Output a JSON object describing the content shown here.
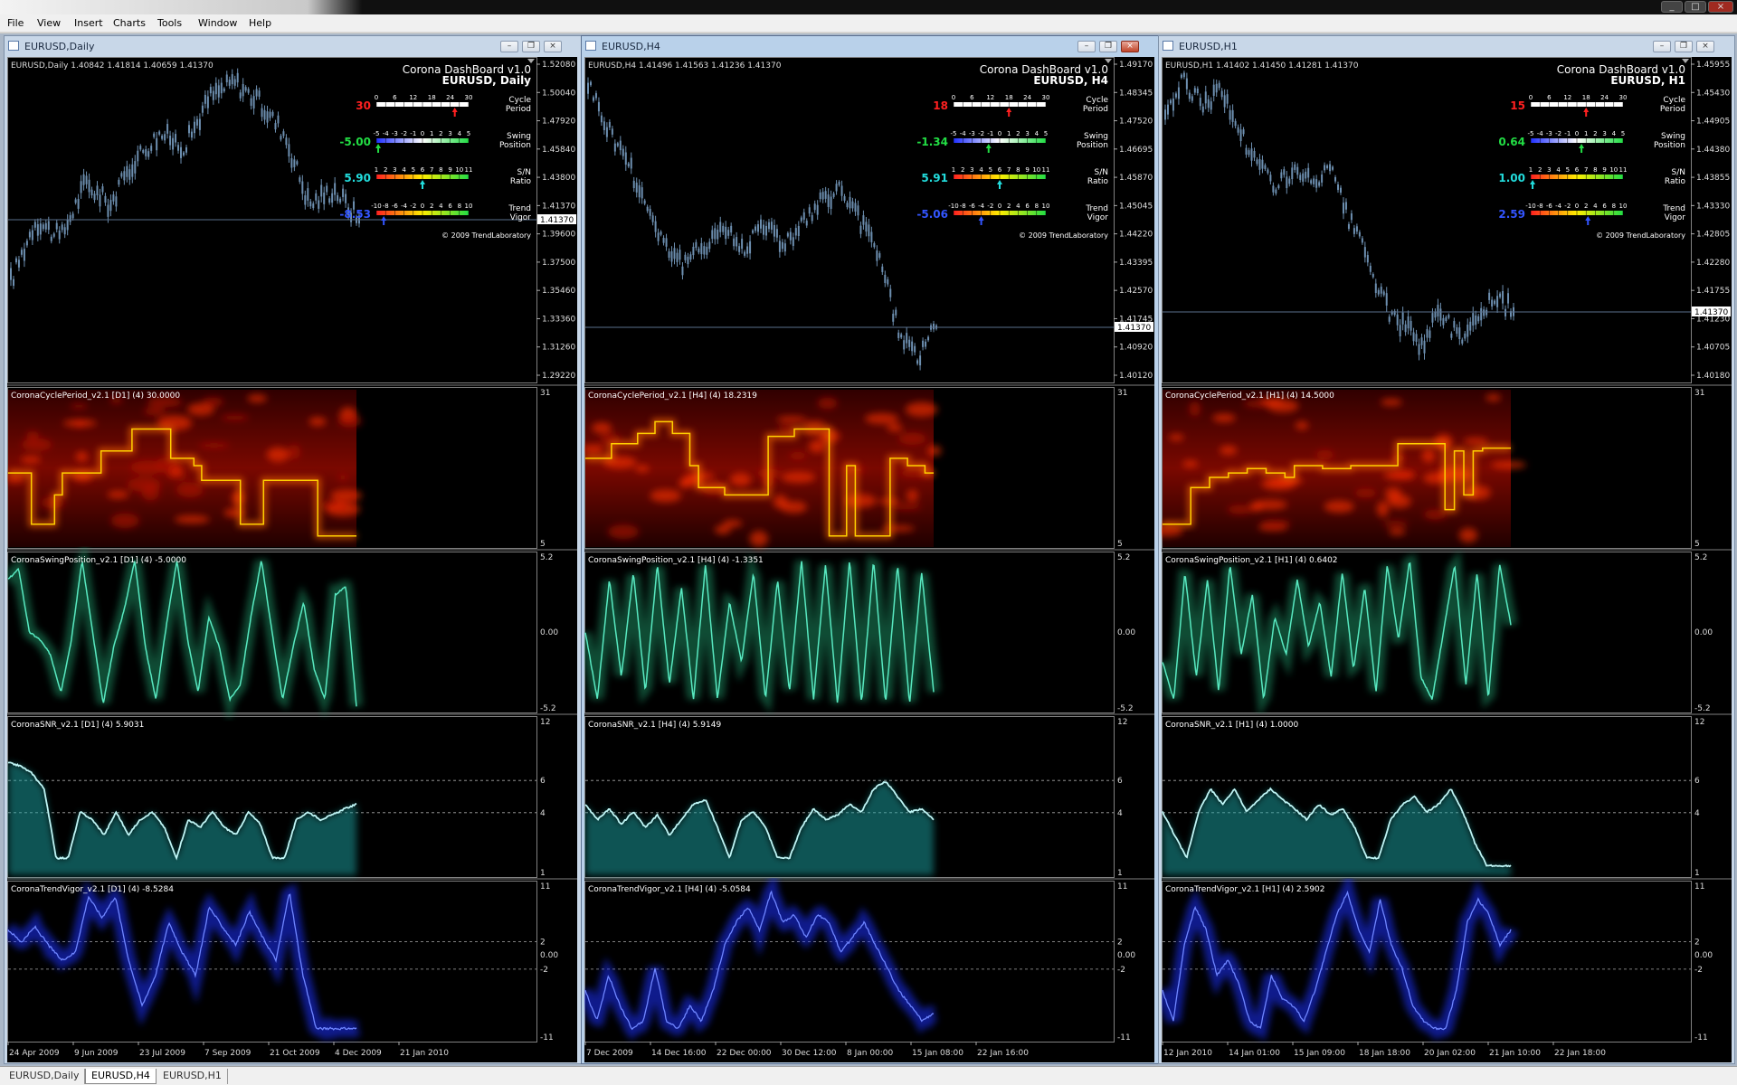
{
  "menu": [
    "File",
    "View",
    "Insert",
    "Charts",
    "Tools",
    "Window",
    "Help"
  ],
  "bottom_tabs": [
    "EURUSD,Daily",
    "EURUSD,H4",
    "EURUSD,H1"
  ],
  "active_tab": 1,
  "colors": {
    "chart_bg": "#000000",
    "candle": "#6d8fb0",
    "cycle_line": "#ffd000",
    "swing": "#58e8c0",
    "snr": "#bff5f5",
    "trend": "#4060ff",
    "dash_red": "#ff2020",
    "dash_green": "#22dd44",
    "dash_cyan": "#22dddd",
    "dash_blue": "#3355ff"
  },
  "copyright": "© 2009 TrendLaboratory",
  "dashboard_title": "Corona DashBoard v1.0",
  "dash_labels": {
    "cycle1": "Cycle",
    "cycle2": "Period",
    "swing1": "Swing",
    "swing2": "Position",
    "sn1": "S/N",
    "sn2": "Ratio",
    "tv1": "Trend",
    "tv2": "Vigor"
  },
  "dash_scales": {
    "cycle": [
      "0",
      "6",
      "12",
      "18",
      "24",
      "30"
    ],
    "swing": [
      "-5",
      "-4",
      "-3",
      "-2",
      "-1",
      "0",
      "1",
      "2",
      "3",
      "4",
      "5"
    ],
    "sn": [
      "1",
      "2",
      "3",
      "4",
      "5",
      "6",
      "7",
      "8",
      "9",
      "10",
      "11"
    ],
    "tv": [
      "-10",
      "-8",
      "-6",
      "-4",
      "-2",
      "0",
      "2",
      "4",
      "6",
      "8",
      "10"
    ]
  },
  "windows": [
    {
      "title": "EURUSD,Daily",
      "active": false,
      "ohlc": "EURUSD,Daily  1.40842 1.41814 1.40659 1.41370",
      "symbol": "EURUSD, Daily",
      "cycle_value": "30",
      "swing_value": "-5.00",
      "sn_value": "5.90",
      "tv_value": "-8.53",
      "price_axis": [
        "1.52080",
        "1.50040",
        "1.47920",
        "1.45840",
        "1.43800",
        "1.41370",
        "1.39600",
        "1.37500",
        "1.35460",
        "1.33360",
        "1.31260",
        "1.29220"
      ],
      "current_price": "1.41370",
      "cycle_title": "CoronaCyclePeriod_v2.1 [D1] (4) 30.0000",
      "swing_title": "CoronaSwingPosition_v2.1 [D1] (4) -5.0000",
      "snr_title": "CoronaSNR_v2.1 [D1] (4) 5.9031",
      "tv_title": "CoronaTrendVigor_v2.1 [D1] (4) -8.5284",
      "dates": [
        "24 Apr 2009",
        "9 Jun 2009",
        "23 Jul 2009",
        "7 Sep 2009",
        "21 Oct 2009",
        "4 Dec 2009",
        "21 Jan 2010"
      ],
      "price_path": [
        0.3,
        0.5,
        0.44,
        0.62,
        0.55,
        0.7,
        0.78,
        0.74,
        0.9,
        0.95,
        0.88,
        0.78,
        0.55,
        0.6,
        0.5
      ],
      "cycle_path": [
        0.45,
        0.45,
        0.45,
        0.1,
        0.1,
        0.1,
        0.3,
        0.45,
        0.45,
        0.45,
        0.45,
        0.45,
        0.6,
        0.6,
        0.6,
        0.6,
        0.75,
        0.75,
        0.75,
        0.75,
        0.75,
        0.55,
        0.55,
        0.55,
        0.5,
        0.4,
        0.4,
        0.4,
        0.4,
        0.4,
        0.1,
        0.1,
        0.1,
        0.4,
        0.4,
        0.4,
        0.4,
        0.4,
        0.4,
        0.4,
        0.02,
        0.02,
        0.02,
        0.02,
        0.02
      ],
      "swing_path": [
        0.85,
        0.92,
        0.5,
        0.45,
        0.35,
        0.1,
        0.45,
        0.98,
        0.5,
        0.02,
        0.4,
        0.65,
        0.98,
        0.4,
        0.05,
        0.55,
        0.98,
        0.45,
        0.1,
        0.6,
        0.4,
        0.05,
        0.15,
        0.6,
        0.98,
        0.5,
        0.05,
        0.4,
        0.7,
        0.25,
        0.05,
        0.75,
        0.8,
        0.0
      ],
      "snr_path": [
        0.72,
        0.7,
        0.65,
        0.55,
        0.1,
        0.1,
        0.4,
        0.35,
        0.25,
        0.4,
        0.25,
        0.35,
        0.4,
        0.3,
        0.1,
        0.35,
        0.3,
        0.4,
        0.3,
        0.25,
        0.4,
        0.32,
        0.1,
        0.1,
        0.35,
        0.4,
        0.35,
        0.38,
        0.42,
        0.45
      ],
      "tv_path": [
        0.7,
        0.62,
        0.72,
        0.6,
        0.5,
        0.55,
        0.92,
        0.78,
        0.92,
        0.5,
        0.2,
        0.4,
        0.75,
        0.55,
        0.4,
        0.85,
        0.72,
        0.6,
        0.82,
        0.65,
        0.5,
        0.95,
        0.4,
        0.05,
        0.05,
        0.05,
        0.05
      ]
    },
    {
      "title": "EURUSD,H4",
      "active": true,
      "ohlc": "EURUSD,H4  1.41496 1.41563 1.41236 1.41370",
      "symbol": "EURUSD, H4",
      "cycle_value": "18",
      "swing_value": "-1.34",
      "sn_value": "5.91",
      "tv_value": "-5.06",
      "price_axis": [
        "1.49170",
        "1.48345",
        "1.47520",
        "1.46695",
        "1.45870",
        "1.45045",
        "1.44220",
        "1.43395",
        "1.42570",
        "1.41745",
        "1.40920",
        "1.40120"
      ],
      "current_price": "1.41370",
      "cycle_title": "CoronaCyclePeriod_v2.1 [H4] (4) 18.2319",
      "swing_title": "CoronaSwingPosition_v2.1 [H4] (4) -1.3351",
      "snr_title": "CoronaSNR_v2.1 [H4] (4) 5.9149",
      "tv_title": "CoronaTrendVigor_v2.1 [H4] (4) -5.0584",
      "dates": [
        "7 Dec 2009",
        "14 Dec 16:00",
        "22 Dec 00:00",
        "30 Dec 12:00",
        "8 Jan 00:00",
        "15 Jan 08:00",
        "22 Jan 16:00"
      ],
      "price_path": [
        0.95,
        0.8,
        0.7,
        0.55,
        0.42,
        0.35,
        0.42,
        0.48,
        0.4,
        0.5,
        0.42,
        0.48,
        0.55,
        0.6,
        0.5,
        0.4,
        0.15,
        0.05,
        0.15
      ],
      "cycle_path": [
        0.55,
        0.55,
        0.55,
        0.65,
        0.65,
        0.65,
        0.72,
        0.72,
        0.8,
        0.8,
        0.72,
        0.72,
        0.5,
        0.35,
        0.35,
        0.35,
        0.3,
        0.3,
        0.3,
        0.3,
        0.3,
        0.7,
        0.7,
        0.7,
        0.75,
        0.75,
        0.75,
        0.75,
        0.02,
        0.02,
        0.5,
        0.02,
        0.02,
        0.02,
        0.02,
        0.55,
        0.55,
        0.5,
        0.5,
        0.45
      ],
      "swing_path": [
        0.5,
        0.05,
        0.85,
        0.2,
        0.9,
        0.1,
        0.95,
        0.15,
        0.8,
        0.05,
        0.95,
        0.05,
        0.7,
        0.3,
        0.9,
        0.05,
        0.85,
        0.1,
        0.98,
        0.05,
        0.95,
        0.02,
        0.98,
        0.02,
        0.98,
        0.02,
        0.95,
        0.02,
        0.9,
        0.1
      ],
      "snr_path": [
        0.45,
        0.35,
        0.42,
        0.32,
        0.4,
        0.3,
        0.38,
        0.25,
        0.35,
        0.45,
        0.48,
        0.3,
        0.1,
        0.35,
        0.4,
        0.3,
        0.1,
        0.1,
        0.3,
        0.42,
        0.35,
        0.38,
        0.45,
        0.4,
        0.55,
        0.6,
        0.5,
        0.4,
        0.42,
        0.35
      ],
      "tv_path": [
        0.3,
        0.1,
        0.4,
        0.2,
        0.05,
        0.1,
        0.45,
        0.1,
        0.05,
        0.2,
        0.1,
        0.3,
        0.6,
        0.75,
        0.85,
        0.7,
        0.95,
        0.75,
        0.8,
        0.65,
        0.8,
        0.75,
        0.55,
        0.65,
        0.75,
        0.6,
        0.45,
        0.3,
        0.2,
        0.1,
        0.15
      ]
    },
    {
      "title": "EURUSD,H1",
      "active": false,
      "ohlc": "EURUSD,H1  1.41402 1.41450 1.41281 1.41370",
      "symbol": "EURUSD, H1",
      "cycle_value": "15",
      "swing_value": "0.64",
      "sn_value": "1.00",
      "tv_value": "2.59",
      "price_axis": [
        "1.45955",
        "1.45430",
        "1.44905",
        "1.44380",
        "1.43855",
        "1.43330",
        "1.42805",
        "1.42280",
        "1.41755",
        "1.41230",
        "1.40705",
        "1.40180"
      ],
      "current_price": "1.41370",
      "cycle_title": "CoronaCyclePeriod_v2.1 [H1] (4) 14.5000",
      "swing_title": "CoronaSwingPosition_v2.1 [H1] (4) 0.6402",
      "snr_title": "CoronaSNR_v2.1 [H1] (4) 1.0000",
      "tv_title": "CoronaTrendVigor_v2.1 [H1] (4) 2.5902",
      "dates": [
        "12 Jan 2010",
        "14 Jan 01:00",
        "15 Jan 09:00",
        "18 Jan 18:00",
        "20 Jan 02:00",
        "21 Jan 10:00",
        "22 Jan 18:00"
      ],
      "price_path": [
        0.85,
        0.95,
        0.88,
        0.92,
        0.8,
        0.68,
        0.62,
        0.65,
        0.62,
        0.66,
        0.5,
        0.38,
        0.22,
        0.15,
        0.1,
        0.2,
        0.12,
        0.18,
        0.25,
        0.2
      ],
      "cycle_path": [
        0.1,
        0.1,
        0.1,
        0.35,
        0.35,
        0.42,
        0.42,
        0.45,
        0.45,
        0.48,
        0.48,
        0.45,
        0.45,
        0.42,
        0.5,
        0.5,
        0.5,
        0.48,
        0.48,
        0.48,
        0.5,
        0.5,
        0.5,
        0.5,
        0.5,
        0.65,
        0.65,
        0.65,
        0.65,
        0.65,
        0.2,
        0.6,
        0.3,
        0.6,
        0.62,
        0.62,
        0.62
      ],
      "swing_path": [
        0.3,
        0.05,
        0.9,
        0.2,
        0.85,
        0.1,
        0.95,
        0.35,
        0.75,
        0.05,
        0.6,
        0.35,
        0.85,
        0.4,
        0.7,
        0.2,
        0.9,
        0.25,
        0.8,
        0.1,
        0.95,
        0.45,
        0.98,
        0.2,
        0.05,
        0.5,
        0.95,
        0.15,
        0.9,
        0.05,
        0.95,
        0.55
      ],
      "snr_path": [
        0.4,
        0.25,
        0.1,
        0.4,
        0.55,
        0.45,
        0.55,
        0.4,
        0.48,
        0.55,
        0.48,
        0.42,
        0.35,
        0.45,
        0.38,
        0.42,
        0.3,
        0.1,
        0.1,
        0.35,
        0.45,
        0.5,
        0.4,
        0.45,
        0.55,
        0.4,
        0.2,
        0.05,
        0.05,
        0.05
      ],
      "tv_path": [
        0.3,
        0.1,
        0.6,
        0.85,
        0.7,
        0.4,
        0.5,
        0.35,
        0.1,
        0.05,
        0.4,
        0.25,
        0.2,
        0.1,
        0.3,
        0.55,
        0.8,
        0.95,
        0.7,
        0.55,
        0.9,
        0.6,
        0.45,
        0.2,
        0.1,
        0.05,
        0.05,
        0.3,
        0.75,
        0.9,
        0.8,
        0.6,
        0.7
      ]
    }
  ]
}
